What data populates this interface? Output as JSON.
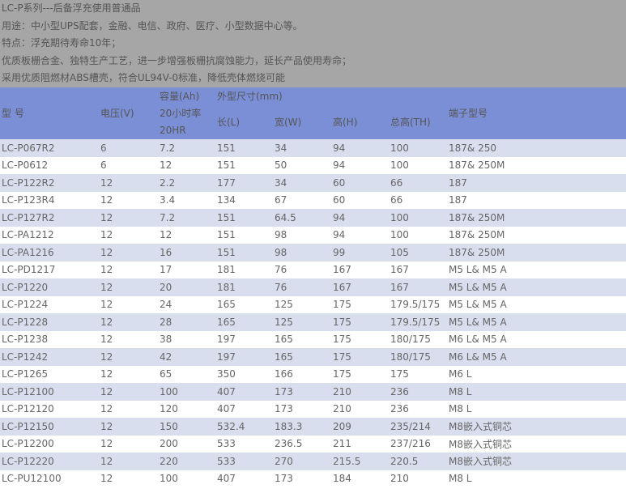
{
  "intro": [
    "LC-P系列---后备浮充使用普通品",
    "用途：中小型UPS配套，金融、电信、政府、医疗、小型数据中心等。",
    "特点：浮充期待寿命10年；",
    "优质板栅合金、独特生产工艺，进一步增强板栅抗腐蚀能力，延长产品使用寿命；",
    "采用优质阻燃材ABS槽壳，符合UL94V-0标准，降低壳体燃烧可能"
  ],
  "header": {
    "model": "型  号",
    "voltage": "电压(V)",
    "capacity_l1": "容量(Ah)",
    "capacity_l2": "20小时率",
    "capacity_l3": "20HR",
    "dimensions": "外型尺寸(mm)",
    "length": "长(L)",
    "width": "宽(W)",
    "height": "高(H)",
    "total_height": "总高(TH)",
    "terminal": "端子型号"
  },
  "rows": [
    [
      "LC-P067R2",
      "6",
      "7.2",
      "151",
      "34",
      "94",
      "100",
      "187& 250"
    ],
    [
      "LC-P0612",
      "6",
      "12",
      "151",
      "50",
      "94",
      "100",
      "187& 250M"
    ],
    [
      "LC-P122R2",
      "12",
      "2.2",
      "177",
      "34",
      "60",
      "66",
      "187"
    ],
    [
      "LC-P123R4",
      "12",
      "3.4",
      "134",
      "67",
      "60",
      "66",
      "187"
    ],
    [
      "LC-P127R2",
      "12",
      "7.2",
      "151",
      "64.5",
      "94",
      "100",
      "187& 250M"
    ],
    [
      "LC-PA1212",
      "12",
      "12",
      "151",
      "98",
      "94",
      "100",
      "187& 250M"
    ],
    [
      "LC-PA1216",
      "12",
      "16",
      "151",
      "98",
      "99",
      "105",
      "187& 250M"
    ],
    [
      "LC-PD1217",
      "12",
      "17",
      "181",
      "76",
      "167",
      "167",
      "M5 L& M5 A"
    ],
    [
      "LC-P1220",
      "12",
      "20",
      "181",
      "76",
      "167",
      "167",
      "M5 L& M5 A"
    ],
    [
      "LC-P1224",
      "12",
      "24",
      "165",
      "125",
      "175",
      "179.5/175",
      "M5 L& M5 A"
    ],
    [
      "LC-P1228",
      "12",
      "28",
      "165",
      "125",
      "175",
      "179.5/175",
      "M5 L& M5 A"
    ],
    [
      "LC-P1238",
      "12",
      "38",
      "197",
      "165",
      "175",
      "180/175",
      "M6 L& M5 A"
    ],
    [
      "LC-P1242",
      "12",
      "42",
      "197",
      "165",
      "175",
      "180/175",
      "M6 L& M5 A"
    ],
    [
      "LC-P1265",
      "12",
      "65",
      "350",
      "166",
      "175",
      "175",
      "M6 L"
    ],
    [
      "LC-P12100",
      "12",
      "100",
      "407",
      "173",
      "210",
      "236",
      "M8 L"
    ],
    [
      "LC-P12120",
      "12",
      "120",
      "407",
      "173",
      "210",
      "236",
      "M8 L"
    ],
    [
      "LC-P12150",
      "12",
      "150",
      "532.4",
      "183.3",
      "209",
      "235/214",
      "M8嵌入式铜芯"
    ],
    [
      "LC-P12200",
      "12",
      "200",
      "533",
      "236.5",
      "211",
      "237/216",
      "M8嵌入式铜芯"
    ],
    [
      "LC-P12220",
      "12",
      "220",
      "533",
      "270",
      "215.5",
      "220.5",
      "M8嵌入式铜芯"
    ],
    [
      "LC-PU12100",
      "12",
      "100",
      "407",
      "173",
      "184",
      "210",
      "M8 L"
    ]
  ],
  "colors": {
    "intro_bg": "#a6a6a6",
    "header_bg": "#7b8fd6",
    "row_alt": "#d9deee"
  }
}
